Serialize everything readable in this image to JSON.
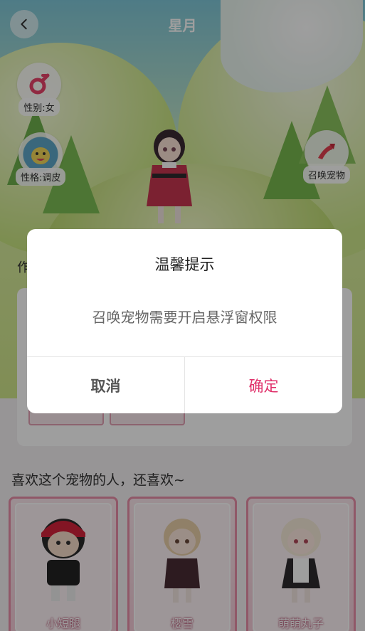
{
  "header": {
    "title": "星月",
    "back_icon": "chevron-left-icon"
  },
  "badges": {
    "gender": {
      "label": "性别:女",
      "icon": "female-symbol-icon",
      "color": "#e8436a"
    },
    "personality": {
      "label": "性格:调皮",
      "icon": "mischievous-face-icon"
    },
    "summon": {
      "label": "召唤宠物",
      "icon": "summon-arrow-icon",
      "color": "#e34050"
    }
  },
  "section": {
    "label_partial": "作"
  },
  "recommend": {
    "title": "喜欢这个宠物的人，还喜欢~",
    "items": [
      {
        "name": "小短腿"
      },
      {
        "name": "樱雪"
      },
      {
        "name": "萌萌丸子"
      }
    ]
  },
  "dialog": {
    "title": "温馨提示",
    "message": "召唤宠物需要开启悬浮窗权限",
    "cancel_label": "取消",
    "confirm_label": "确定",
    "confirm_color": "#e0306a"
  }
}
